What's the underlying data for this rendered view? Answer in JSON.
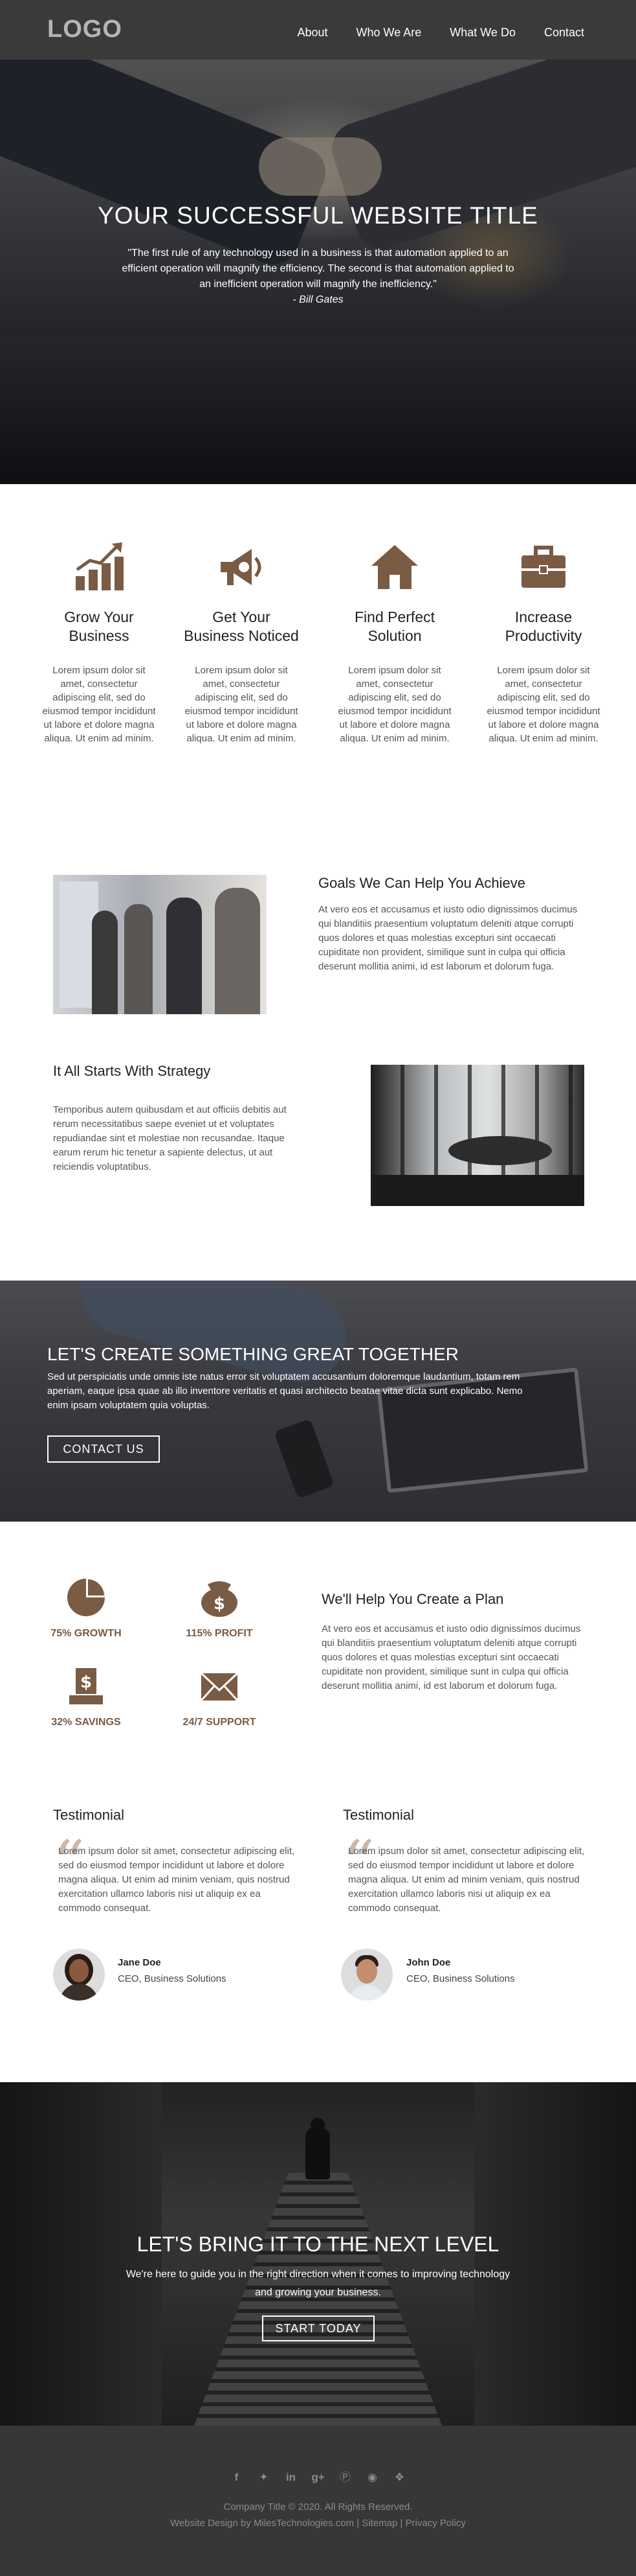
{
  "header": {
    "logo": "LOGO",
    "nav": [
      "About",
      "Who We Are",
      "What We Do",
      "Contact"
    ]
  },
  "hero": {
    "title": "YOUR SUCCESSFUL WEBSITE TITLE",
    "quote": "\"The first rule of any technology used in a business is that automation applied to an efficient operation will magnify the efficiency. The second is that automation applied to an inefficient operation will magnify the inefficiency.\"",
    "author": "- Bill Gates"
  },
  "services": [
    {
      "icon": "bar-chart-icon",
      "title_line1": "Grow Your",
      "title_line2": "Business",
      "text": "Lorem ipsum dolor sit amet, consectetur adipiscing elit, sed do eiusmod tempor incididunt ut labore et dolore magna aliqua. Ut enim ad minim."
    },
    {
      "icon": "megaphone-icon",
      "title_line1": "Get Your",
      "title_line2": "Business Noticed",
      "text": "Lorem ipsum dolor sit amet, consectetur adipiscing elit, sed do eiusmod tempor incididunt ut labore et dolore magna aliqua. Ut enim ad minim."
    },
    {
      "icon": "home-icon",
      "title_line1": "Find Perfect",
      "title_line2": "Solution",
      "text": "Lorem ipsum dolor sit amet, consectetur adipiscing elit, sed do eiusmod tempor incididunt ut labore et dolore magna aliqua. Ut enim ad minim."
    },
    {
      "icon": "briefcase-icon",
      "title_line1": "Increase",
      "title_line2": "Productivity",
      "text": "Lorem ipsum dolor sit amet, consectetur adipiscing elit, sed do eiusmod tempor incididunt ut labore et dolore magna aliqua. Ut enim ad minim."
    }
  ],
  "features": {
    "goals": {
      "title": "Goals We Can Help You Achieve",
      "text": "At vero eos et accusamus et iusto odio dignissimos ducimus qui blanditiis praesentium voluptatum deleniti atque corrupti quos dolores et quas molestias excepturi sint occaecati cupiditate non provident, similique sunt in culpa qui officia deserunt mollitia animi, id est laborum et dolorum fuga."
    },
    "strategy": {
      "title": "It All Starts With Strategy",
      "text": "Temporibus autem quibusdam et aut officiis debitis aut rerum necessitatibus saepe eveniet ut et voluptates repudiandae sint et molestiae non recusandae. Itaque earum rerum hic tenetur a sapiente delectus, ut aut reiciendis voluptatibus."
    }
  },
  "cta": {
    "title": "LET'S CREATE SOMETHING GREAT TOGETHER",
    "text": "Sed ut perspiciatis unde omnis iste natus error sit voluptatem accusantium doloremque laudantium, totam rem aperiam, eaque ipsa quae ab illo inventore veritatis et quasi architecto beatae vitae dicta sunt explicabo. Nemo enim ipsam voluptatem quia voluptas.",
    "button": "CONTACT US"
  },
  "stats": [
    {
      "icon": "pie-chart-icon",
      "label": "75% GROWTH"
    },
    {
      "icon": "money-bag-icon",
      "label": "115% PROFIT"
    },
    {
      "icon": "cash-register-icon",
      "label": "32% SAVINGS"
    },
    {
      "icon": "envelope-icon",
      "label": "24/7 SUPPORT"
    }
  ],
  "plan": {
    "title": "We'll Help You Create a Plan",
    "text": "At vero eos et accusamus et iusto odio dignissimos ducimus qui blanditiis praesentium voluptatum deleniti atque corrupti quos dolores et quas molestias excepturi sint occaecati cupiditate non provident, similique sunt in culpa qui officia deserunt mollitia animi, id est laborum et dolorum fuga."
  },
  "testimonials": [
    {
      "heading": "Testimonial",
      "text": "Lorem ipsum dolor sit amet, consectetur adipiscing elit, sed do eiusmod tempor incididunt ut labore et dolore magna aliqua. Ut enim ad minim veniam, quis nostrud exercitation ullamco laboris nisi ut aliquip ex ea commodo consequat.",
      "name": "Jane Doe",
      "role": "CEO, Business Solutions"
    },
    {
      "heading": "Testimonial",
      "text": "Lorem ipsum dolor sit amet, consectetur adipiscing elit, sed do eiusmod tempor incididunt ut labore et dolore magna aliqua. Ut enim ad minim veniam, quis nostrud exercitation ullamco laboris nisi ut aliquip ex ea commodo consequat.",
      "name": "John Doe",
      "role": "CEO, Business Solutions"
    }
  ],
  "next_level": {
    "title": "LET'S BRING IT TO THE NEXT LEVEL",
    "text": "We're here to guide you in the right direction when it comes to improving technology and growing your business.",
    "button": "START TODAY"
  },
  "footer": {
    "socials": [
      "facebook-icon",
      "twitter-icon",
      "linkedin-icon",
      "google-plus-icon",
      "pinterest-icon",
      "reddit-icon",
      "dropbox-icon"
    ],
    "copyright": "Company Title © 2020. All Rights Reserved.",
    "credits": "Website Design by MilesTechnologies.com | Sitemap | Privacy Policy"
  },
  "colors": {
    "accent": "#7a5b44",
    "header_bg": "#3a3a3a",
    "footer_bg": "#373737"
  }
}
